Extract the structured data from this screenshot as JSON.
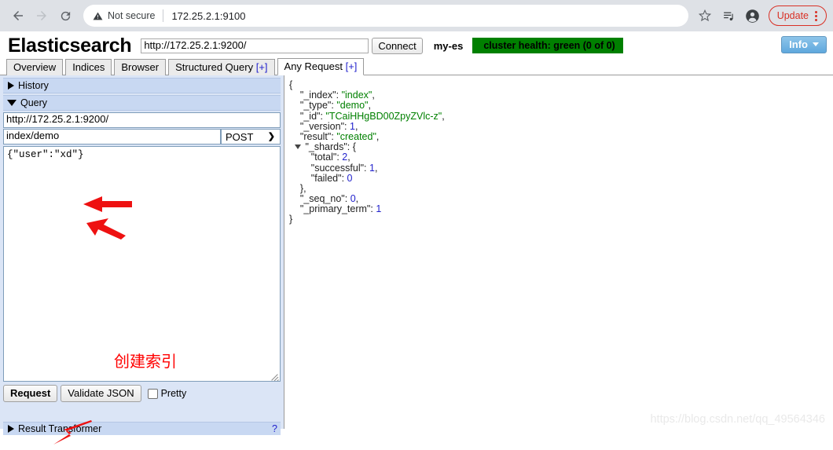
{
  "browser": {
    "back_icon": "back-arrow-icon",
    "forward_icon": "forward-arrow-icon",
    "reload_icon": "reload-icon",
    "security_label": "Not secure",
    "warning_icon": "warning-triangle-icon",
    "url": "172.25.2.1:9100",
    "bookmark_icon": "star-icon",
    "reading_list_icon": "reading-list-icon",
    "profile_icon": "profile-avatar-icon",
    "update_label": "Update",
    "menu_icon": "three-dot-menu-icon"
  },
  "header": {
    "logo": "Elasticsearch",
    "host_value": "http://172.25.2.1:9200/",
    "connect_label": "Connect",
    "cluster_name": "my-es",
    "health_text": "cluster health: green (0 of 0)",
    "health_color": "#008000",
    "info_label": "Info",
    "info_caret_icon": "caret-down-icon"
  },
  "tabs": [
    {
      "label": "Overview",
      "plus": "",
      "active": false
    },
    {
      "label": "Indices",
      "plus": "",
      "active": false
    },
    {
      "label": "Browser",
      "plus": "",
      "active": false
    },
    {
      "label": "Structured Query",
      "plus": "[+]",
      "active": false
    },
    {
      "label": "Any Request",
      "plus": "[+]",
      "active": true
    }
  ],
  "query_panel": {
    "history_label": "History",
    "history_icon": "triangle-right-icon",
    "query_label": "Query",
    "query_icon": "triangle-down-icon",
    "url_value": "http://172.25.2.1:9200/",
    "path_value": "index/demo",
    "method_value": "POST",
    "method_caret_icon": "chevron-down-icon",
    "body_value": "{\"user\":\"xd\"}",
    "request_label": "Request",
    "validate_label": "Validate JSON",
    "pretty_label": "Pretty",
    "pretty_checked": false,
    "result_transformer_label": "Result Transformer",
    "result_transformer_icon": "triangle-right-icon",
    "result_transformer_link": "?"
  },
  "response": {
    "lines": [
      {
        "indent": 0,
        "twisty": false,
        "key": "",
        "sep": "",
        "value": "{",
        "vtype": "plain",
        "comma": ""
      },
      {
        "indent": 1,
        "twisty": false,
        "key": "\"_index\"",
        "sep": ": ",
        "value": "\"index\"",
        "vtype": "string",
        "comma": ","
      },
      {
        "indent": 1,
        "twisty": false,
        "key": "\"_type\"",
        "sep": ": ",
        "value": "\"demo\"",
        "vtype": "string",
        "comma": ","
      },
      {
        "indent": 1,
        "twisty": false,
        "key": "\"_id\"",
        "sep": ": ",
        "value": "\"TCaiHHgBD00ZpyZVlc-z\"",
        "vtype": "string",
        "comma": ","
      },
      {
        "indent": 1,
        "twisty": false,
        "key": "\"_version\"",
        "sep": ": ",
        "value": "1",
        "vtype": "number",
        "comma": ","
      },
      {
        "indent": 1,
        "twisty": false,
        "key": "\"result\"",
        "sep": ": ",
        "value": "\"created\"",
        "vtype": "string",
        "comma": ","
      },
      {
        "indent": 1,
        "twisty": true,
        "key": "\"_shards\"",
        "sep": ": ",
        "value": "{",
        "vtype": "plain",
        "comma": ""
      },
      {
        "indent": 2,
        "twisty": false,
        "key": "\"total\"",
        "sep": ": ",
        "value": "2",
        "vtype": "number",
        "comma": ","
      },
      {
        "indent": 2,
        "twisty": false,
        "key": "\"successful\"",
        "sep": ": ",
        "value": "1",
        "vtype": "number",
        "comma": ","
      },
      {
        "indent": 2,
        "twisty": false,
        "key": "\"failed\"",
        "sep": ": ",
        "value": "0",
        "vtype": "number",
        "comma": ""
      },
      {
        "indent": 1,
        "twisty": false,
        "key": "",
        "sep": "",
        "value": "},",
        "vtype": "plain",
        "comma": ""
      },
      {
        "indent": 1,
        "twisty": false,
        "key": "\"_seq_no\"",
        "sep": ": ",
        "value": "0",
        "vtype": "number",
        "comma": ","
      },
      {
        "indent": 1,
        "twisty": false,
        "key": "\"_primary_term\"",
        "sep": ": ",
        "value": "1",
        "vtype": "number",
        "comma": ""
      },
      {
        "indent": 0,
        "twisty": false,
        "key": "",
        "sep": "",
        "value": "}",
        "vtype": "plain",
        "comma": ""
      }
    ]
  },
  "annotations": {
    "chinese_note": "创建索引",
    "note_color": "#ff0000",
    "arrow_count": 3
  },
  "watermark": "https://blog.csdn.net/qq_49564346"
}
